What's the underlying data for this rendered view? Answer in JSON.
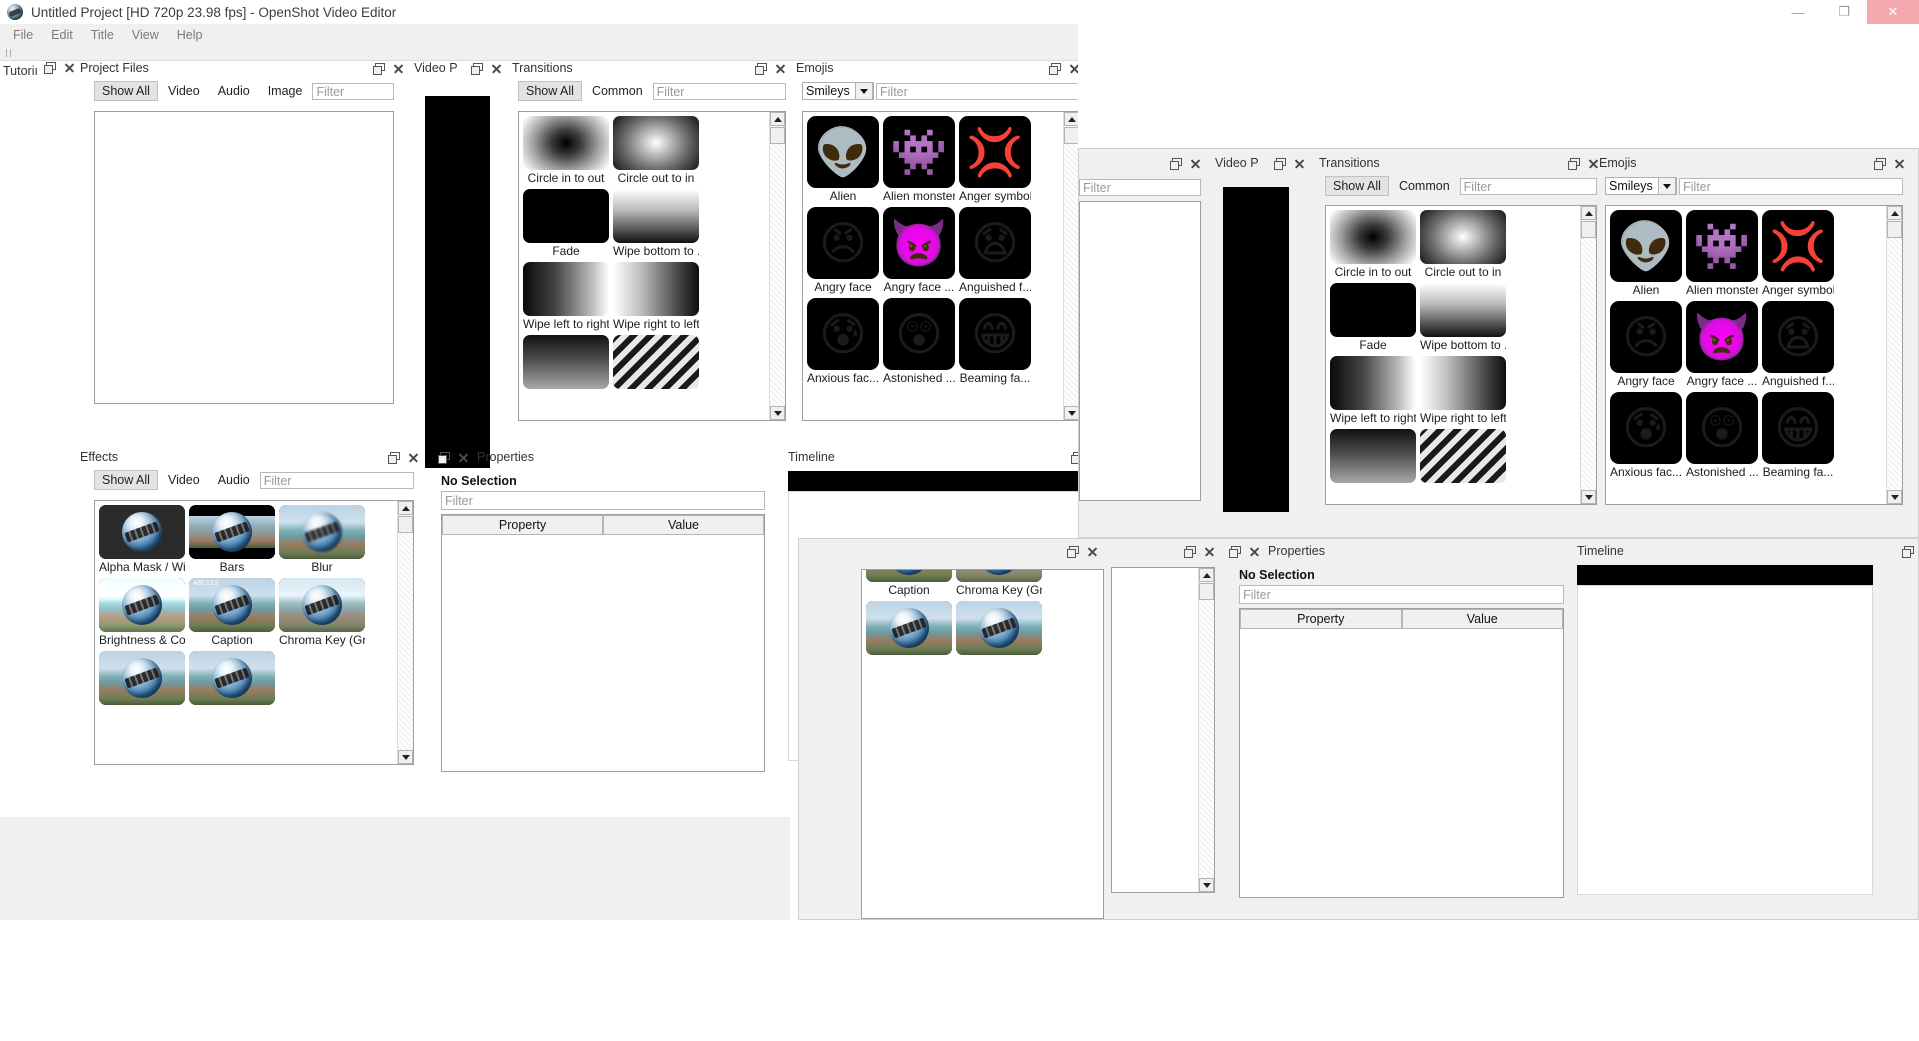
{
  "app": {
    "title": "Untitled Project [HD 720p 23.98 fps] - OpenShot Video Editor",
    "logo_icon": "openshot-logo-icon",
    "minimize_label": "—",
    "restore_label": "❐",
    "close_label": "✕"
  },
  "menu": {
    "items": [
      "File",
      "Edit",
      "Title",
      "View",
      "Help"
    ]
  },
  "panels": {
    "tutorial": {
      "title": "Tutoriı"
    },
    "project_files": {
      "title": "Project Files",
      "tabs": [
        "Show All",
        "Video",
        "Audio",
        "Image"
      ],
      "selected_tab": "Show All",
      "filter_placeholder": "Filter"
    },
    "video_preview": {
      "title": "Video P"
    },
    "transitions": {
      "title": "Transitions",
      "tabs": [
        "Show All",
        "Common"
      ],
      "selected_tab": "Show All",
      "filter_placeholder": "Filter",
      "items": [
        {
          "label": "Circle in to out",
          "thumb": "t-circle-in"
        },
        {
          "label": "Circle out to in",
          "thumb": "t-circle-out"
        },
        {
          "label": "Fade",
          "thumb": "t-fade"
        },
        {
          "label": "Wipe bottom to ...",
          "thumb": "t-wipe-b"
        },
        {
          "label": "Wipe left to right",
          "thumb": "t-wipe-lr"
        },
        {
          "label": "Wipe right to left",
          "thumb": "t-wipe-rl"
        },
        {
          "label": "",
          "thumb": "t-wipe-b2"
        },
        {
          "label": "",
          "thumb": "t-diag"
        }
      ]
    },
    "emojis": {
      "title": "Emojis",
      "category_selected": "Smileys",
      "filter_placeholder": "Filter",
      "items": [
        {
          "label": "Alien",
          "glyph": "👽"
        },
        {
          "label": "Alien monster",
          "glyph": "👾"
        },
        {
          "label": "Anger symbol",
          "glyph": "💢"
        },
        {
          "label": "Angry face",
          "glyph": "😠"
        },
        {
          "label": "Angry face ...",
          "glyph": "👿"
        },
        {
          "label": "Anguished f...",
          "glyph": "😧"
        },
        {
          "label": "Anxious fac...",
          "glyph": "😰"
        },
        {
          "label": "Astonished ...",
          "glyph": "😲"
        },
        {
          "label": "Beaming fa...",
          "glyph": "😁"
        }
      ]
    },
    "effects": {
      "title": "Effects",
      "tabs": [
        "Show All",
        "Video",
        "Audio"
      ],
      "selected_tab": "Show All",
      "filter_placeholder": "Filter",
      "items": [
        {
          "label": "Alpha Mask / Wi...",
          "thumb": "alpha"
        },
        {
          "label": "Bars",
          "thumb": "bars"
        },
        {
          "label": "Blur",
          "thumb": "blur"
        },
        {
          "label": "Brightness & Co...",
          "thumb": "bright"
        },
        {
          "label": "Caption",
          "thumb": "caption"
        },
        {
          "label": "Chroma Key (Gr...",
          "thumb": "chroma"
        },
        {
          "label": "",
          "thumb": "more1"
        },
        {
          "label": "",
          "thumb": "more2"
        }
      ]
    },
    "properties": {
      "title": "Properties",
      "selection_status": "No Selection",
      "filter_placeholder": "Filter",
      "columns": [
        "Property",
        "Value"
      ],
      "rows": []
    },
    "timeline": {
      "title": "Timeline"
    }
  },
  "colors": {
    "window_bg": "#f0f0f0",
    "panel_border": "#9e9e9e",
    "close_button": "#f4a7ad",
    "selected_tab": "#e3e3e3",
    "preview_black": "#000000"
  }
}
